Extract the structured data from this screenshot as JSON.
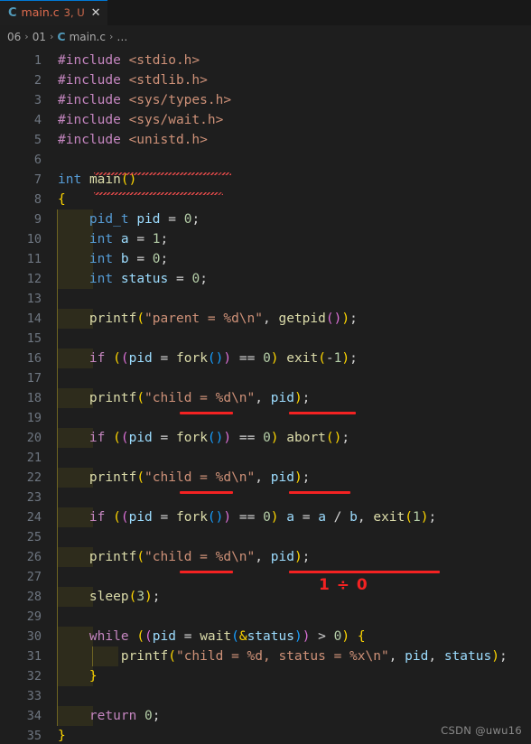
{
  "window": {
    "background_color": "#1e1e1e",
    "tabbar_color": "#181818"
  },
  "tab": {
    "file_icon": "c-language-icon",
    "file_icon_glyph": "C",
    "label": "main.c",
    "badge": "3, U",
    "close_glyph": "✕",
    "label_color": "#e06c4f"
  },
  "breadcrumb": {
    "items": [
      "06",
      "01",
      "main.c"
    ],
    "file_icon_glyph": "C",
    "separator": "›",
    "trailing": "…"
  },
  "code": {
    "lines": [
      {
        "n": "1",
        "indent": 0
      },
      {
        "n": "2",
        "indent": 0
      },
      {
        "n": "3",
        "indent": 0
      },
      {
        "n": "4",
        "indent": 0
      },
      {
        "n": "5",
        "indent": 0
      },
      {
        "n": "6",
        "indent": 0
      },
      {
        "n": "7",
        "indent": 0
      },
      {
        "n": "8",
        "indent": 0
      },
      {
        "n": "9",
        "indent": 1
      },
      {
        "n": "10",
        "indent": 1
      },
      {
        "n": "11",
        "indent": 1
      },
      {
        "n": "12",
        "indent": 1
      },
      {
        "n": "13",
        "indent": 1
      },
      {
        "n": "14",
        "indent": 1
      },
      {
        "n": "15",
        "indent": 1
      },
      {
        "n": "16",
        "indent": 1
      },
      {
        "n": "17",
        "indent": 1
      },
      {
        "n": "18",
        "indent": 1
      },
      {
        "n": "19",
        "indent": 1
      },
      {
        "n": "20",
        "indent": 1
      },
      {
        "n": "21",
        "indent": 1
      },
      {
        "n": "22",
        "indent": 1
      },
      {
        "n": "23",
        "indent": 1
      },
      {
        "n": "24",
        "indent": 1
      },
      {
        "n": "25",
        "indent": 1
      },
      {
        "n": "26",
        "indent": 1
      },
      {
        "n": "27",
        "indent": 1
      },
      {
        "n": "28",
        "indent": 1
      },
      {
        "n": "29",
        "indent": 1
      },
      {
        "n": "30",
        "indent": 1
      },
      {
        "n": "31",
        "indent": 2
      },
      {
        "n": "32",
        "indent": 1
      },
      {
        "n": "33",
        "indent": 1
      },
      {
        "n": "34",
        "indent": 1
      },
      {
        "n": "35",
        "indent": 0
      }
    ],
    "text": [
      "#include <stdio.h>",
      "#include <stdlib.h>",
      "#include <sys/types.h>",
      "#include <sys/wait.h>",
      "#include <unistd.h>",
      "",
      "int main()",
      "{",
      "    pid_t pid = 0;",
      "    int a = 1;",
      "    int b = 0;",
      "    int status = 0;",
      "",
      "    printf(\"parent = %d\\n\", getpid());",
      "",
      "    if ((pid = fork()) == 0) exit(-1);",
      "",
      "    printf(\"child = %d\\n\", pid);",
      "",
      "    if ((pid = fork()) == 0) abort();",
      "",
      "    printf(\"child = %d\\n\", pid);",
      "",
      "    if ((pid = fork()) == 0) a = a / b, exit(1);",
      "",
      "    printf(\"child = %d\\n\", pid);",
      "",
      "    sleep(3);",
      "",
      "    while ((pid = wait(&status)) > 0) {",
      "        printf(\"child = %d, status = %x\\n\", pid, status);",
      "    }",
      "",
      "    return 0;",
      "}"
    ]
  },
  "error_squiggles": [
    {
      "line": "4",
      "target": "#include <sys/wait.h>"
    },
    {
      "line": "5",
      "target": "#include <unistd.h>"
    }
  ],
  "annotations": {
    "color": "#f42222",
    "underlines": [
      {
        "line": "16",
        "target": "fork()"
      },
      {
        "line": "16",
        "target": "exit(-1)"
      },
      {
        "line": "20",
        "target": "fork()"
      },
      {
        "line": "20",
        "target": "abort()"
      },
      {
        "line": "24",
        "target": "fork()"
      },
      {
        "line": "24",
        "target": "a = a / b, exit(1)"
      }
    ],
    "labels": [
      {
        "line": "25",
        "text": "1 ÷ 0"
      }
    ]
  },
  "watermark": {
    "text": "CSDN @uwu16"
  }
}
